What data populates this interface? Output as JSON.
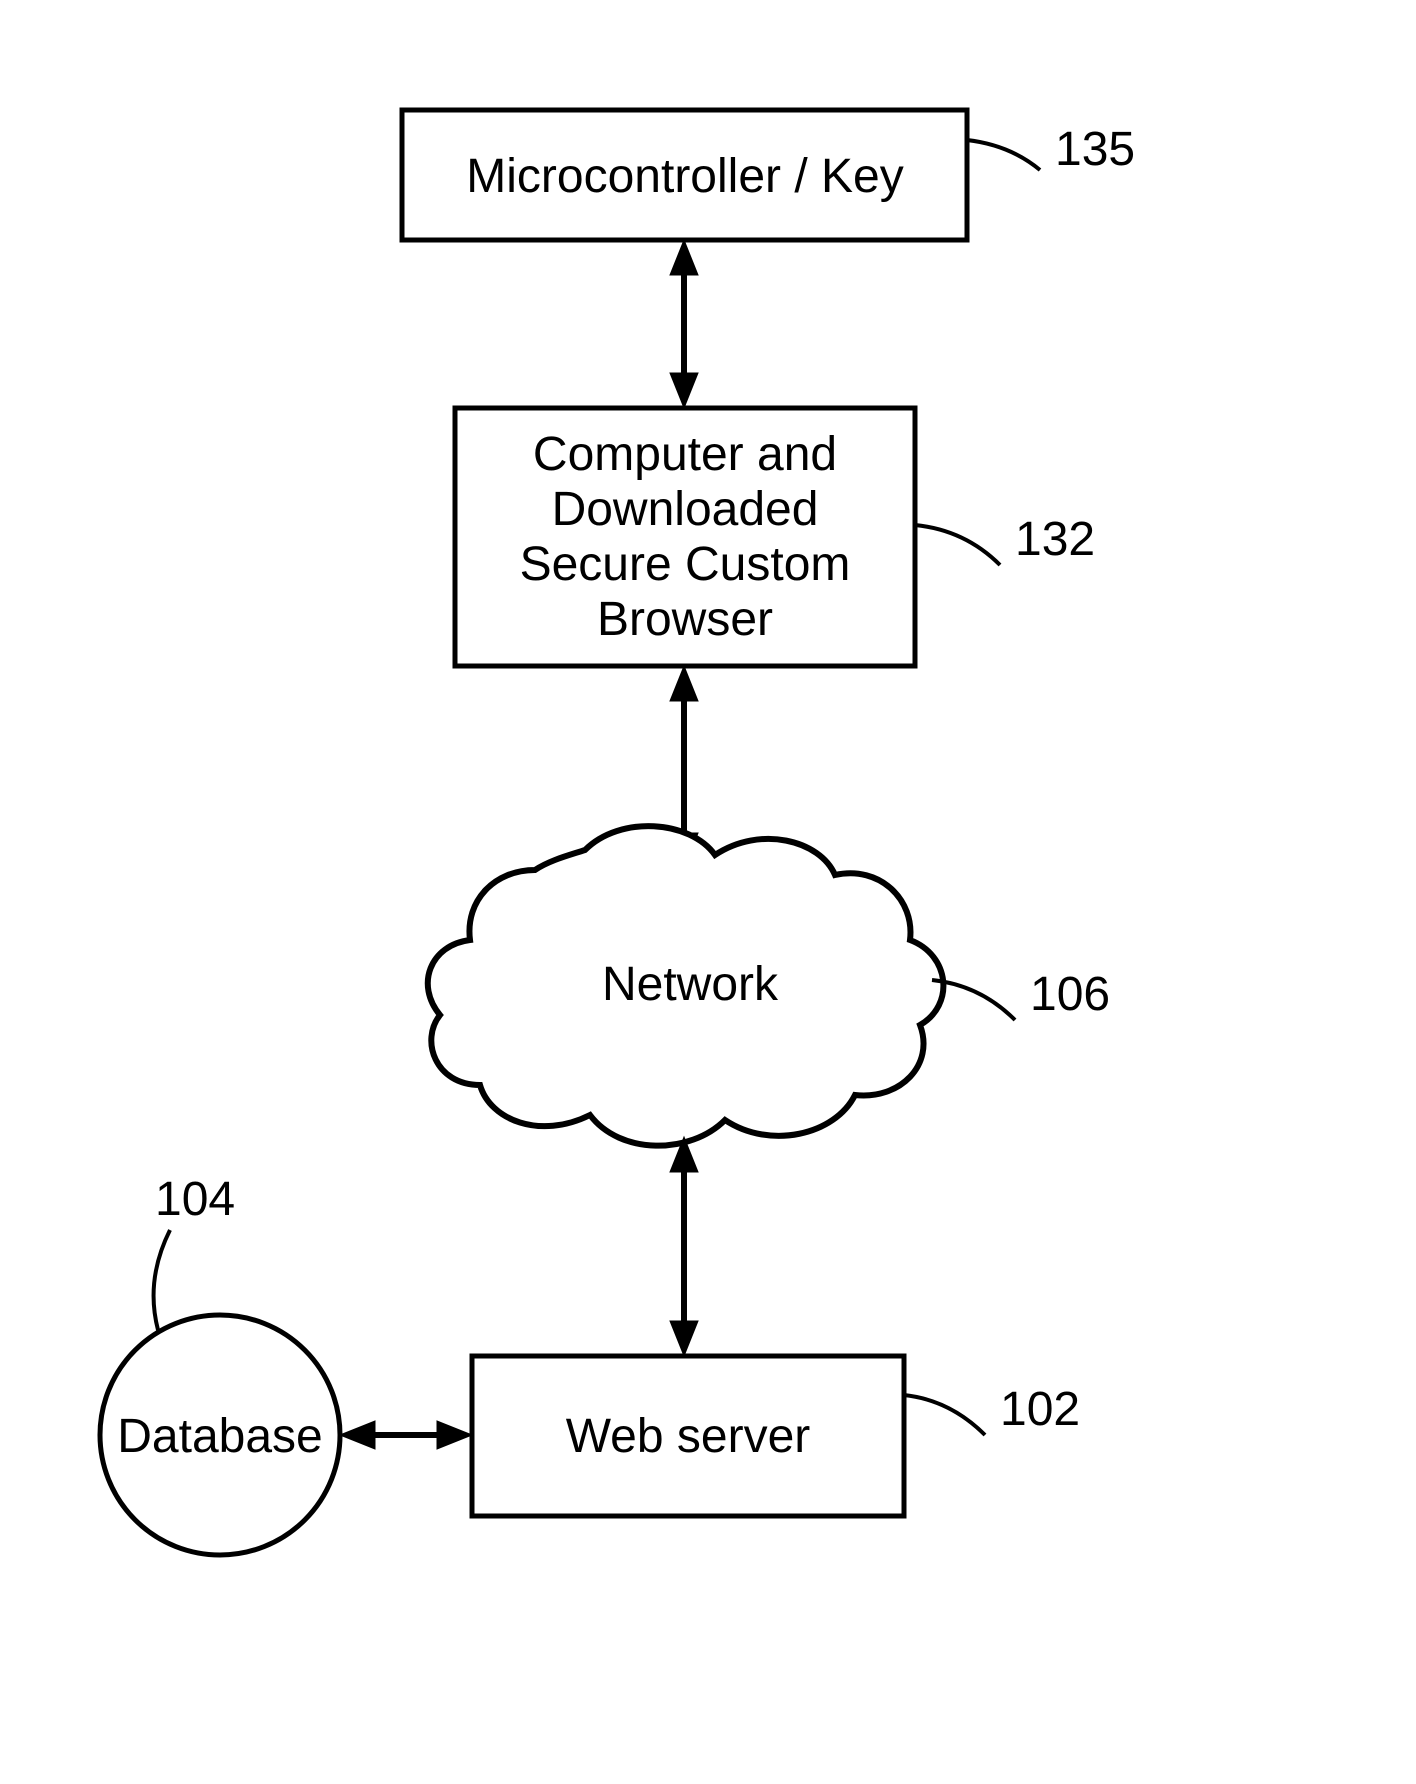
{
  "nodes": {
    "microcontroller": {
      "label": "Microcontroller / Key",
      "ref": "135"
    },
    "computer": {
      "line1": "Computer and",
      "line2": "Downloaded",
      "line3": "Secure Custom",
      "line4": "Browser",
      "ref": "132"
    },
    "network": {
      "label": "Network",
      "ref": "106"
    },
    "webserver": {
      "label": "Web server",
      "ref": "102"
    },
    "database": {
      "label": "Database",
      "ref": "104"
    }
  }
}
